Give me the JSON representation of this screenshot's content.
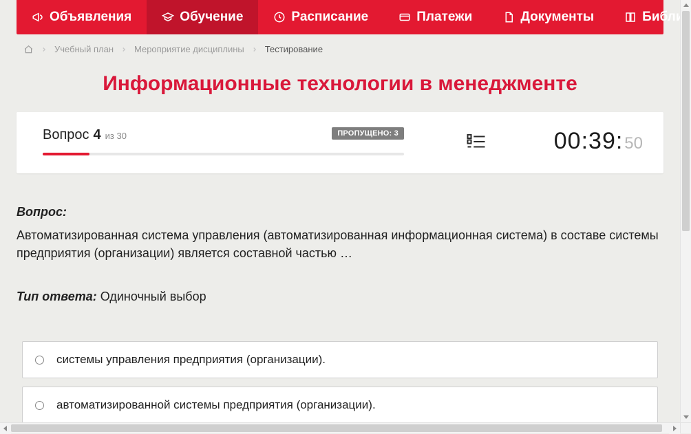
{
  "nav": {
    "items": [
      {
        "label": "Объявления",
        "icon": "megaphone-icon",
        "active": false
      },
      {
        "label": "Обучение",
        "icon": "education-icon",
        "active": true
      },
      {
        "label": "Расписание",
        "icon": "clock-icon",
        "active": false
      },
      {
        "label": "Платежи",
        "icon": "card-icon",
        "active": false
      },
      {
        "label": "Документы",
        "icon": "doc-icon",
        "active": false
      },
      {
        "label": "Библиотека",
        "icon": "book-icon",
        "active": false,
        "has_dropdown": true
      }
    ]
  },
  "breadcrumb": {
    "items": [
      {
        "label": "",
        "is_home": true
      },
      {
        "label": "Учебный план"
      },
      {
        "label": "Мероприятие дисциплины"
      },
      {
        "label": "Тестирование",
        "current": true
      }
    ]
  },
  "page": {
    "title": "Информационные технологии в менеджменте"
  },
  "status": {
    "question_word": "Вопрос",
    "question_number": "4",
    "of_word": "из",
    "total": "30",
    "skipped_label": "ПРОПУЩЕНО: 3",
    "progress_percent": 13,
    "timer_main": "00:39:",
    "timer_tail": "50"
  },
  "question": {
    "heading": "Вопрос:",
    "text": "Автоматизированная система управления (автоматизированная информационная система) в составе системы предприятия (организации) является составной частью …",
    "answer_type_label": "Тип ответа:",
    "answer_type_value": "Одиночный выбор",
    "options": [
      {
        "text": "системы управления предприятия (организации)."
      },
      {
        "text": "автоматизированной системы предприятия (организации)."
      }
    ]
  }
}
